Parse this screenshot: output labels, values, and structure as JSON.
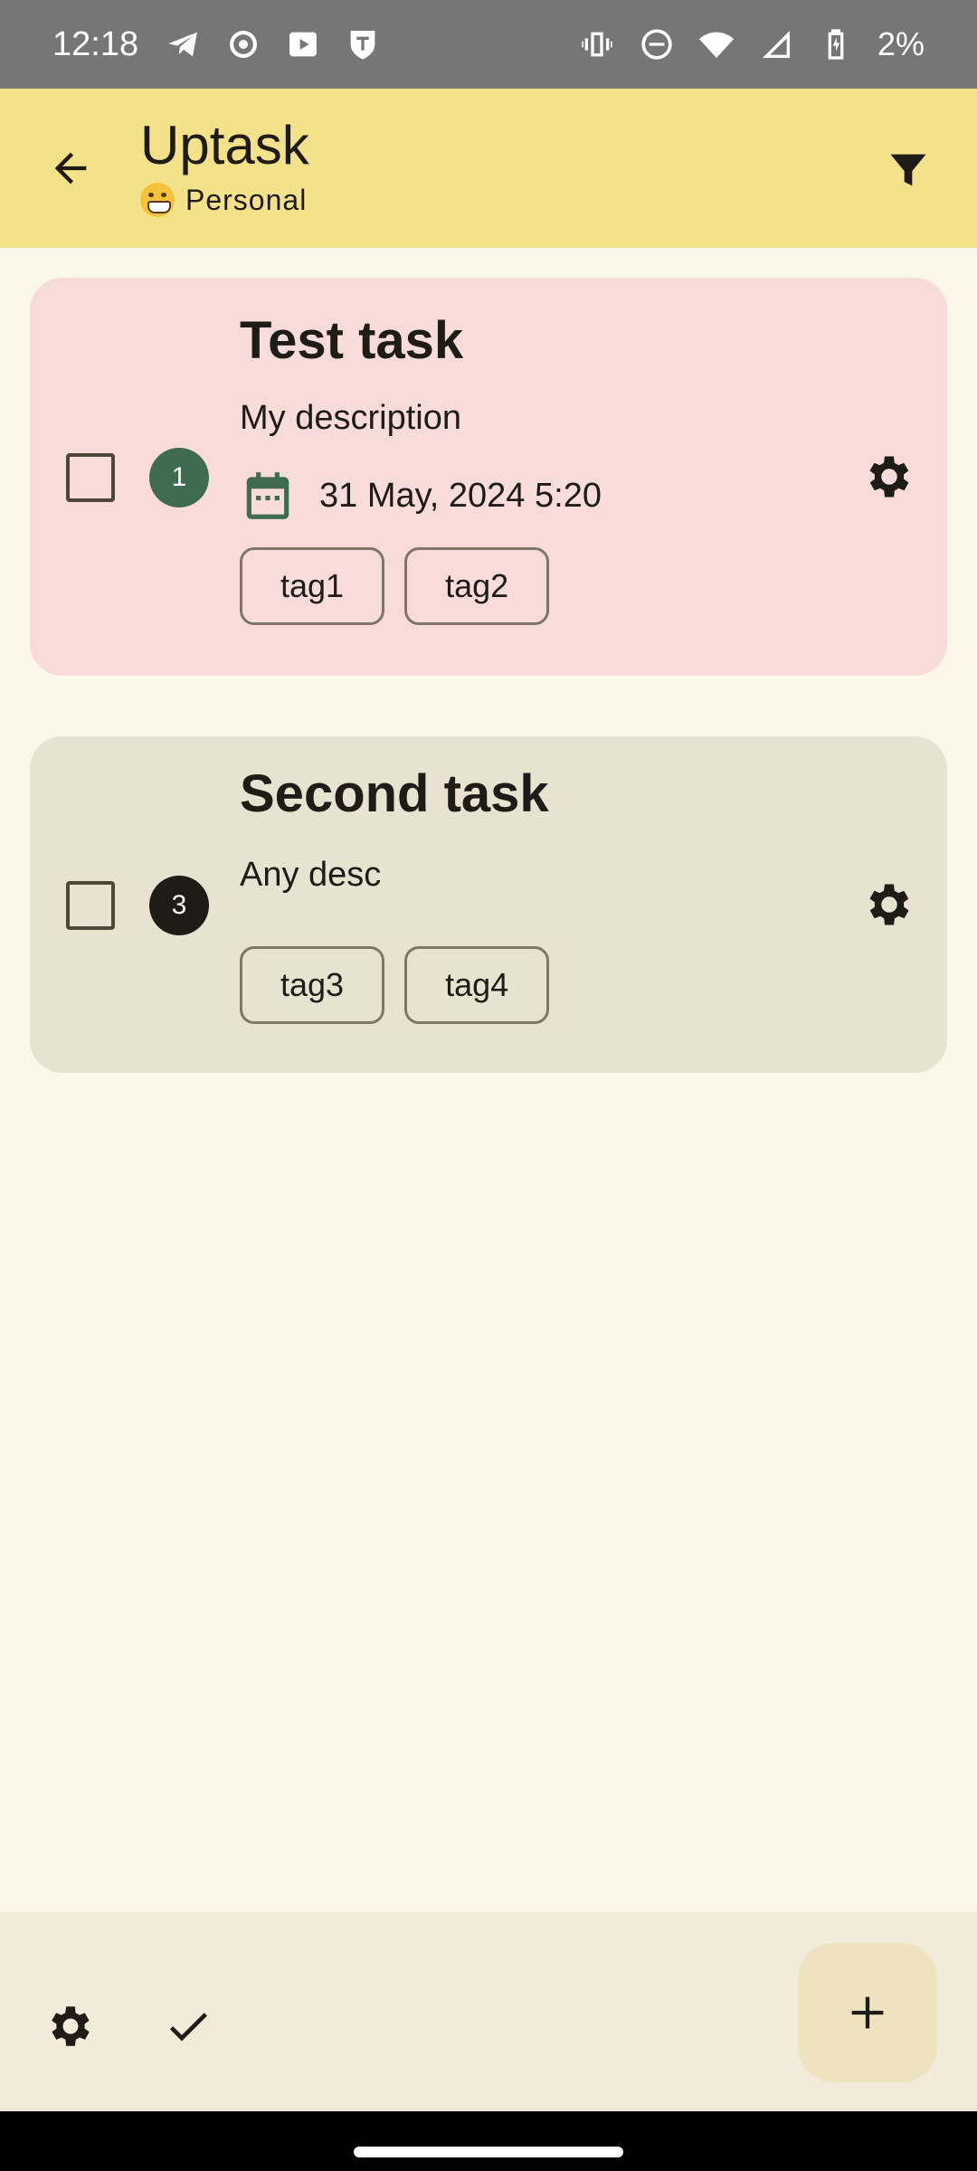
{
  "status_bar": {
    "time": "12:18",
    "battery": "2%",
    "left_icons": [
      "telegram-icon",
      "record-icon",
      "youtube-icon",
      "shield-icon"
    ],
    "right_icons": [
      "vibrate-icon",
      "do-not-disturb-icon",
      "wifi-icon",
      "signal-icon",
      "battery-charging-icon"
    ]
  },
  "app_bar": {
    "title": "Uptask",
    "subtitle": "Personal",
    "subtitle_emoji": "grinning-face-emoji",
    "back_icon": "arrow-back-icon",
    "filter_icon": "filter-icon"
  },
  "tasks": [
    {
      "title": "Test task",
      "description": "My description",
      "priority": "1",
      "priority_color": "#3F6B4F",
      "due": "31 May, 2024 5:20",
      "tags": [
        "tag1",
        "tag2"
      ],
      "card_color": "#F8DCD9",
      "checked": false
    },
    {
      "title": "Second task",
      "description": "Any desc",
      "priority": "3",
      "priority_color": "#1F1B16",
      "due": "",
      "tags": [
        "tag3",
        "tag4"
      ],
      "card_color": "#E8E2D0",
      "checked": false
    }
  ],
  "bottom_bar": {
    "settings_icon": "gear-icon",
    "completed_icon": "check-icon",
    "fab_icon": "plus-icon"
  },
  "colors": {
    "background": "#FDF7EA",
    "app_bar": "#F4E28A",
    "bottom_bar": "#F2EBDA",
    "fab": "#EEE3BE"
  }
}
